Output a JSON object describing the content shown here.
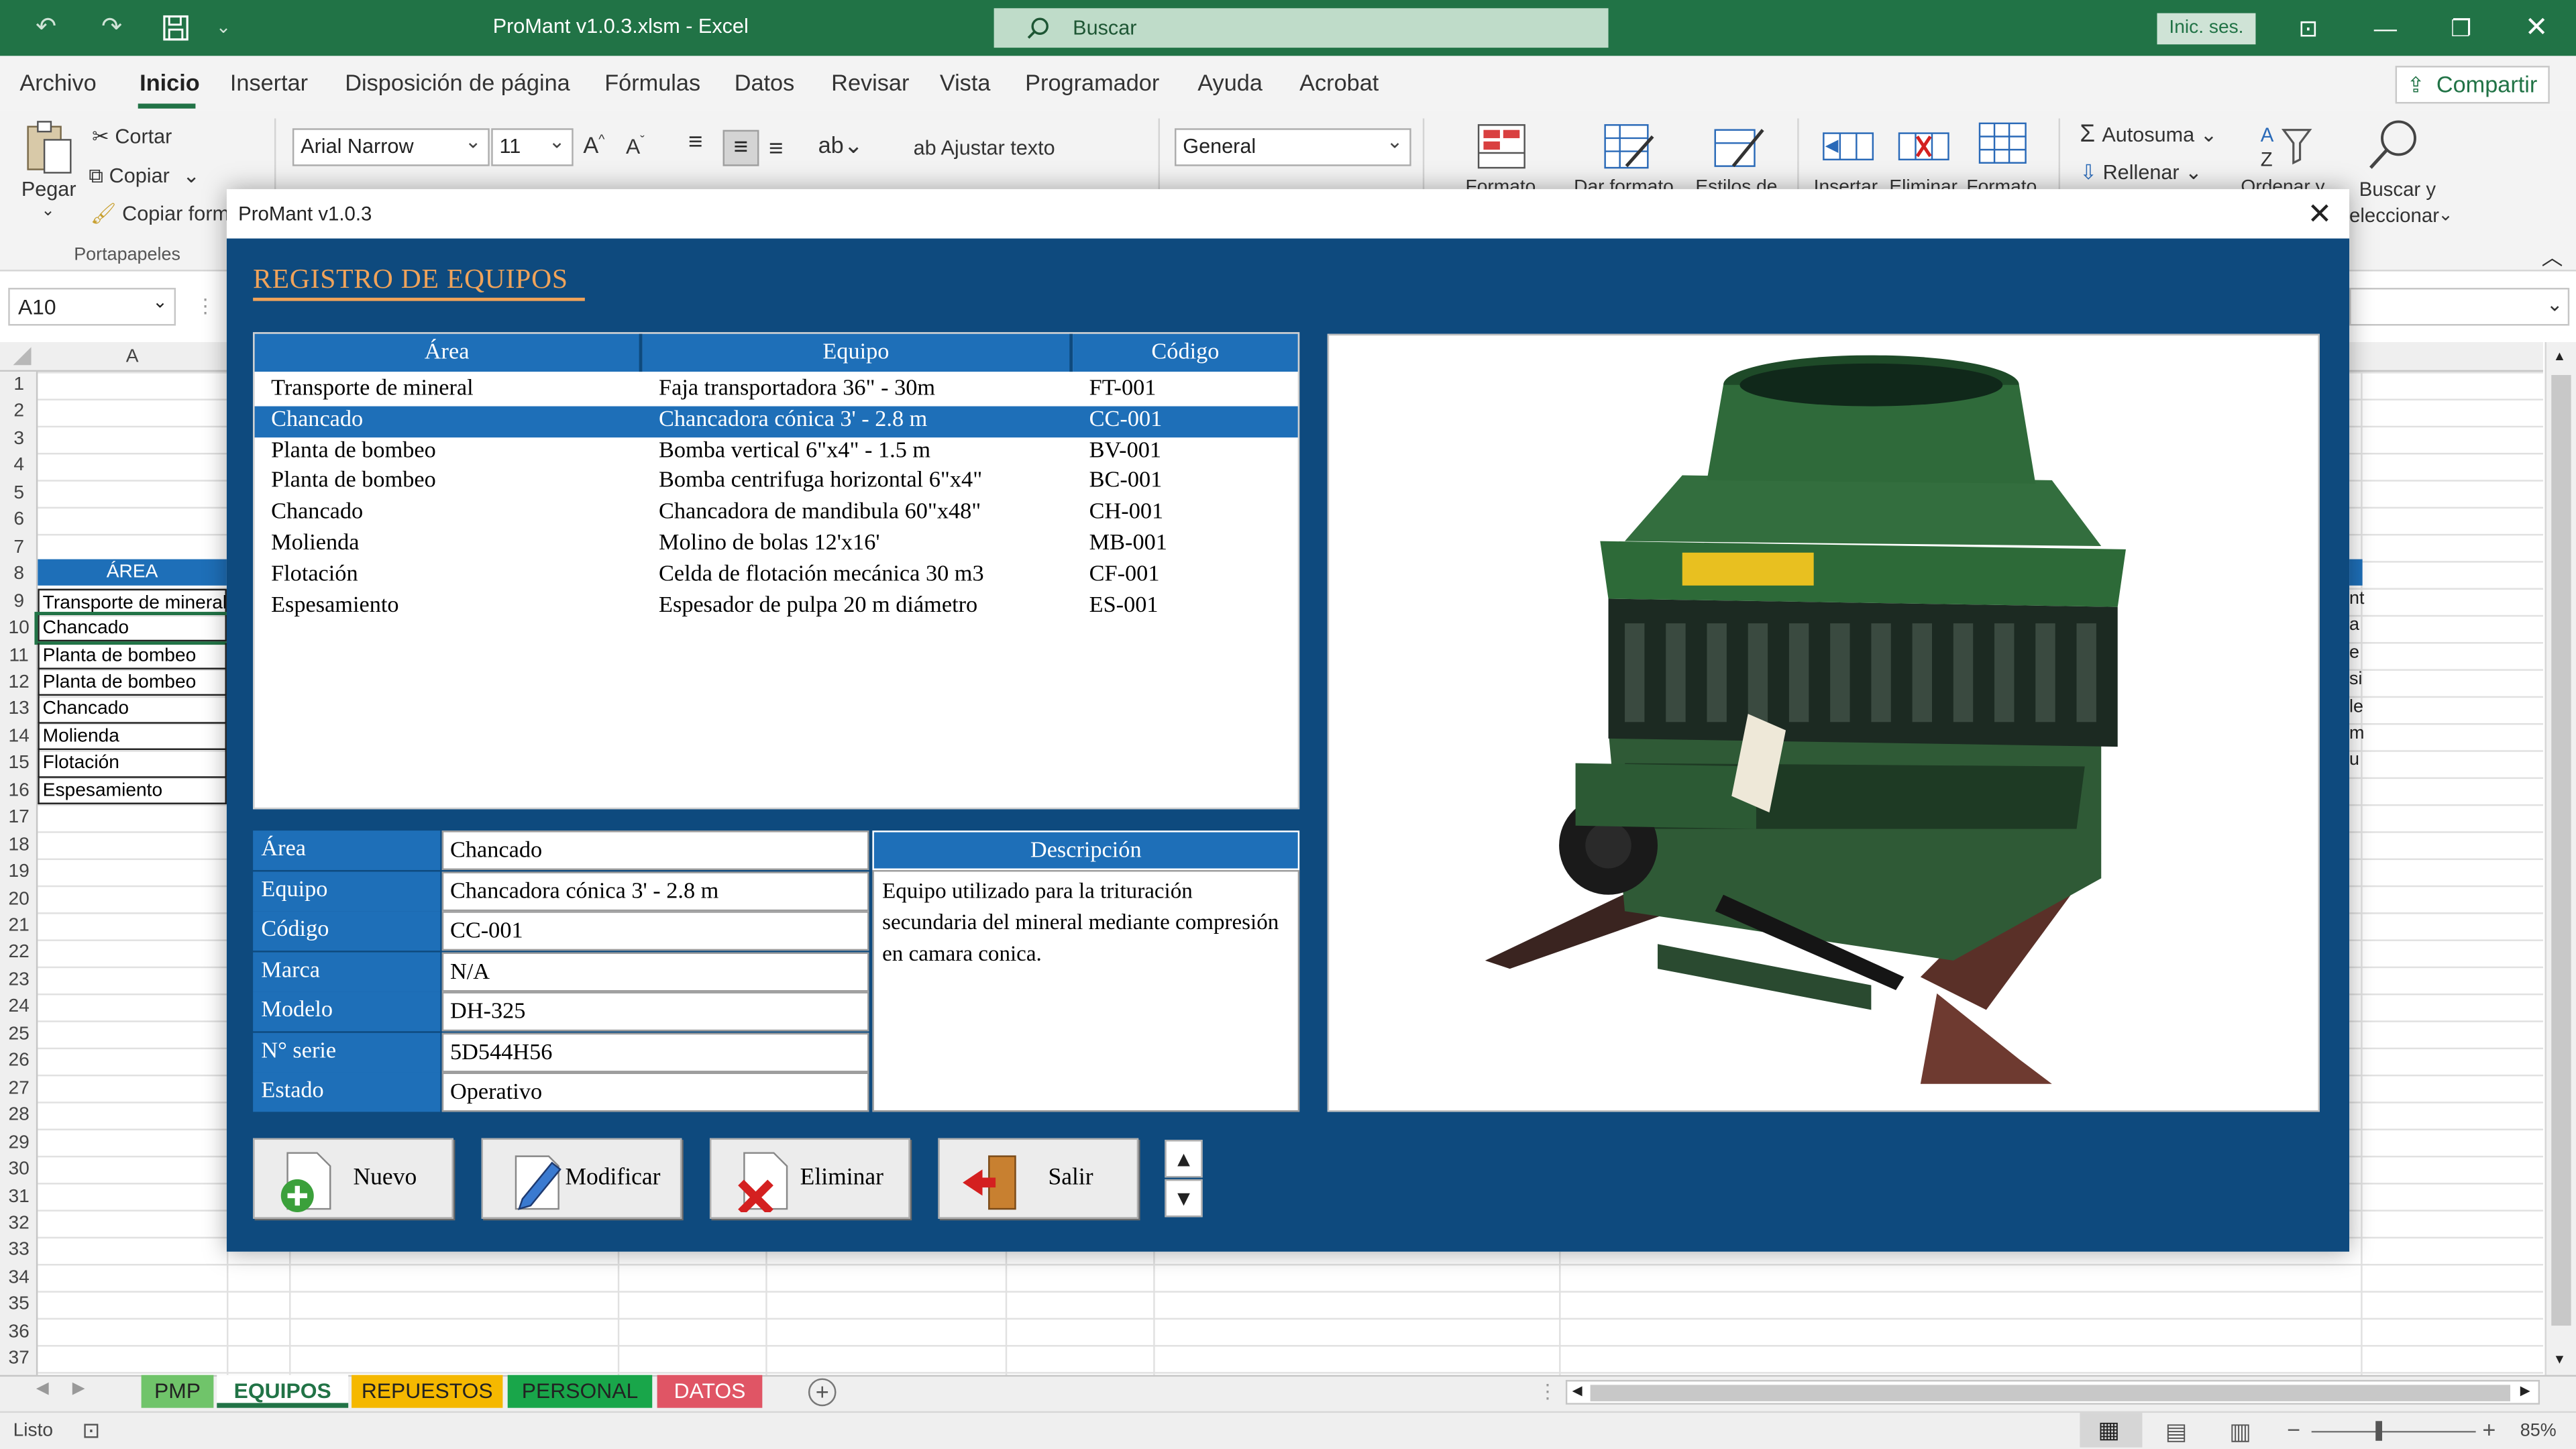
{
  "window": {
    "title": "ProMant v1.0.3.xlsm  -  Excel",
    "search_placeholder": "Buscar",
    "signin": "Inic. ses."
  },
  "menu": {
    "tabs": [
      "Archivo",
      "Inicio",
      "Insertar",
      "Disposición de página",
      "Fórmulas",
      "Datos",
      "Revisar",
      "Vista",
      "Programador",
      "Ayuda",
      "Acrobat"
    ],
    "active": "Inicio",
    "share": "Compartir"
  },
  "ribbon": {
    "paste": "Pegar",
    "cut": "Cortar",
    "copy": "Copiar",
    "format_painter": "Copiar form",
    "clipboard_group": "Portapapeles",
    "font_name": "Arial Narrow",
    "font_size": "11",
    "wrap_text": "Ajustar texto",
    "number_format": "General",
    "cond_format": "Formato",
    "format_table": "Dar formato",
    "cell_styles": "Estilos de",
    "insert": "Insertar",
    "delete": "Eliminar",
    "format": "Formato",
    "autosum": "Autosuma",
    "fill": "Rellenar",
    "sort": "Ordenar y",
    "find": "Buscar y",
    "find2": "eleccionar"
  },
  "formula_bar": {
    "name_box": "A10"
  },
  "sheet": {
    "col_a": "A",
    "row_numbers": [
      "1",
      "2",
      "3",
      "4",
      "5",
      "6",
      "7",
      "8",
      "9",
      "10",
      "11",
      "12",
      "13",
      "14",
      "15",
      "16",
      "17",
      "18",
      "19",
      "20",
      "21",
      "22",
      "23",
      "24",
      "25",
      "26",
      "27",
      "28",
      "29",
      "30",
      "31",
      "32",
      "33",
      "34",
      "35",
      "36",
      "37"
    ],
    "header_cell": "ÁREA",
    "cells": [
      "Transporte de mineral",
      "Chancado",
      "Planta de bombeo",
      "Planta de bombeo",
      "Chancado",
      "Molienda",
      "Flotación",
      "Espesamiento"
    ],
    "right_peek": [
      "nt",
      "a",
      "e",
      "si",
      "le",
      "m",
      "u"
    ]
  },
  "sheet_tabs": [
    {
      "label": "PMP",
      "color": "#70c46a"
    },
    {
      "label": "EQUIPOS",
      "color": "#ffffff"
    },
    {
      "label": "REPUESTOS",
      "color": "#f5b800"
    },
    {
      "label": "PERSONAL",
      "color": "#19a64a"
    },
    {
      "label": "DATOS",
      "color": "#e05565"
    }
  ],
  "status": {
    "ready": "Listo",
    "zoom": "85%"
  },
  "dialog": {
    "title": "ProMant v1.0.3",
    "heading": "REGISTRO DE EQUIPOS",
    "columns": [
      "Área",
      "Equipo",
      "Código"
    ],
    "rows": [
      {
        "area": "Transporte de mineral",
        "equipo": "Faja transportadora 36\" - 30m",
        "codigo": "FT-001"
      },
      {
        "area": "Chancado",
        "equipo": "Chancadora cónica 3' - 2.8 m",
        "codigo": "CC-001"
      },
      {
        "area": "Planta de bombeo",
        "equipo": "Bomba vertical 6\"x4\" - 1.5 m",
        "codigo": "BV-001"
      },
      {
        "area": "Planta de bombeo",
        "equipo": "Bomba centrifuga horizontal 6\"x4\"",
        "codigo": "BC-001"
      },
      {
        "area": "Chancado",
        "equipo": "Chancadora de mandibula 60\"x48\"",
        "codigo": "CH-001"
      },
      {
        "area": "Molienda",
        "equipo": "Molino de bolas 12'x16'",
        "codigo": "MB-001"
      },
      {
        "area": "Flotación",
        "equipo": "Celda de flotación mecánica 30 m3",
        "codigo": "CF-001"
      },
      {
        "area": "Espesamiento",
        "equipo": "Espesador de pulpa 20 m diámetro",
        "codigo": "ES-001"
      }
    ],
    "selected_index": 1,
    "fields": [
      {
        "label": "Área",
        "value": "Chancado"
      },
      {
        "label": "Equipo",
        "value": "Chancadora cónica 3' - 2.8 m"
      },
      {
        "label": "Código",
        "value": "CC-001"
      },
      {
        "label": "Marca",
        "value": "N/A"
      },
      {
        "label": "Modelo",
        "value": "DH-325"
      },
      {
        "label": "N° serie",
        "value": "5D544H56"
      },
      {
        "label": "Estado",
        "value": "Operativo"
      }
    ],
    "description_header": "Descripción",
    "description": "Equipo utilizado para la trituración secundaria del mineral mediante compresión en camara conica.",
    "buttons": {
      "new": "Nuevo",
      "modify": "Modificar",
      "delete": "Eliminar",
      "exit": "Salir"
    }
  }
}
